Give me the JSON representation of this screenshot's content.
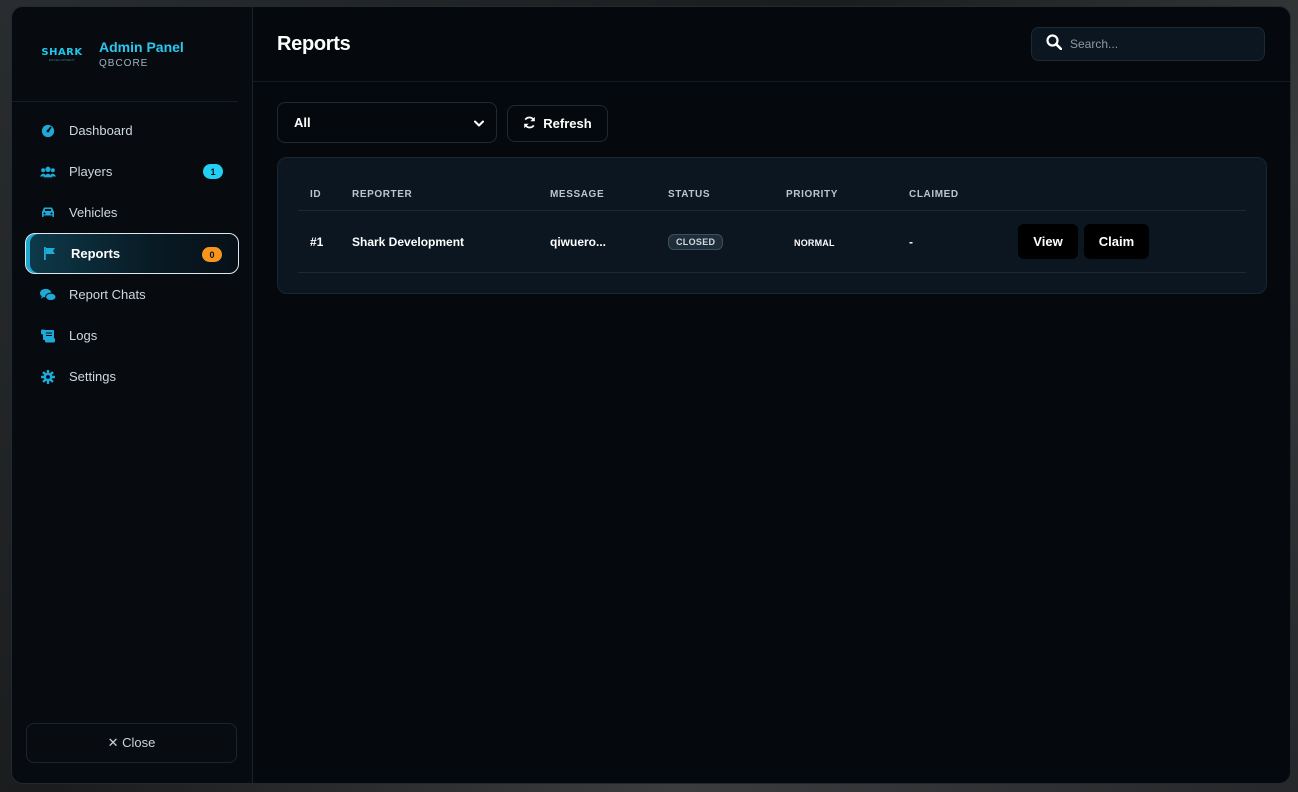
{
  "brand": {
    "logo_text": "SHARK",
    "logo_sub": "DEVELOPMENT",
    "title": "Admin Panel",
    "subtitle": "QBCORE"
  },
  "sidebar": {
    "items": [
      {
        "label": "Dashboard",
        "icon": "gauge-icon"
      },
      {
        "label": "Players",
        "icon": "users-icon",
        "badge": "1"
      },
      {
        "label": "Vehicles",
        "icon": "car-icon"
      },
      {
        "label": "Reports",
        "icon": "flag-icon",
        "badge": "0",
        "active": true
      },
      {
        "label": "Report Chats",
        "icon": "chat-icon"
      },
      {
        "label": "Logs",
        "icon": "scroll-icon"
      },
      {
        "label": "Settings",
        "icon": "gear-icon"
      }
    ],
    "close_label": "✕ Close"
  },
  "header": {
    "title": "Reports",
    "search_placeholder": "Search..."
  },
  "controls": {
    "filter_value": "All",
    "refresh_label": "Refresh"
  },
  "table": {
    "columns": [
      "ID",
      "REPORTER",
      "MESSAGE",
      "STATUS",
      "PRIORITY",
      "CLAIMED"
    ],
    "rows": [
      {
        "id": "#1",
        "reporter": "Shark Development",
        "message": "qiwuero...",
        "status": "CLOSED",
        "priority": "NORMAL",
        "claimed": "-",
        "view_label": "View",
        "claim_label": "Claim"
      }
    ]
  },
  "colors": {
    "accent": "#21c8ef",
    "badge_cyan": "#21d0f2",
    "badge_orange": "#f7941d",
    "background": "#05080c"
  }
}
